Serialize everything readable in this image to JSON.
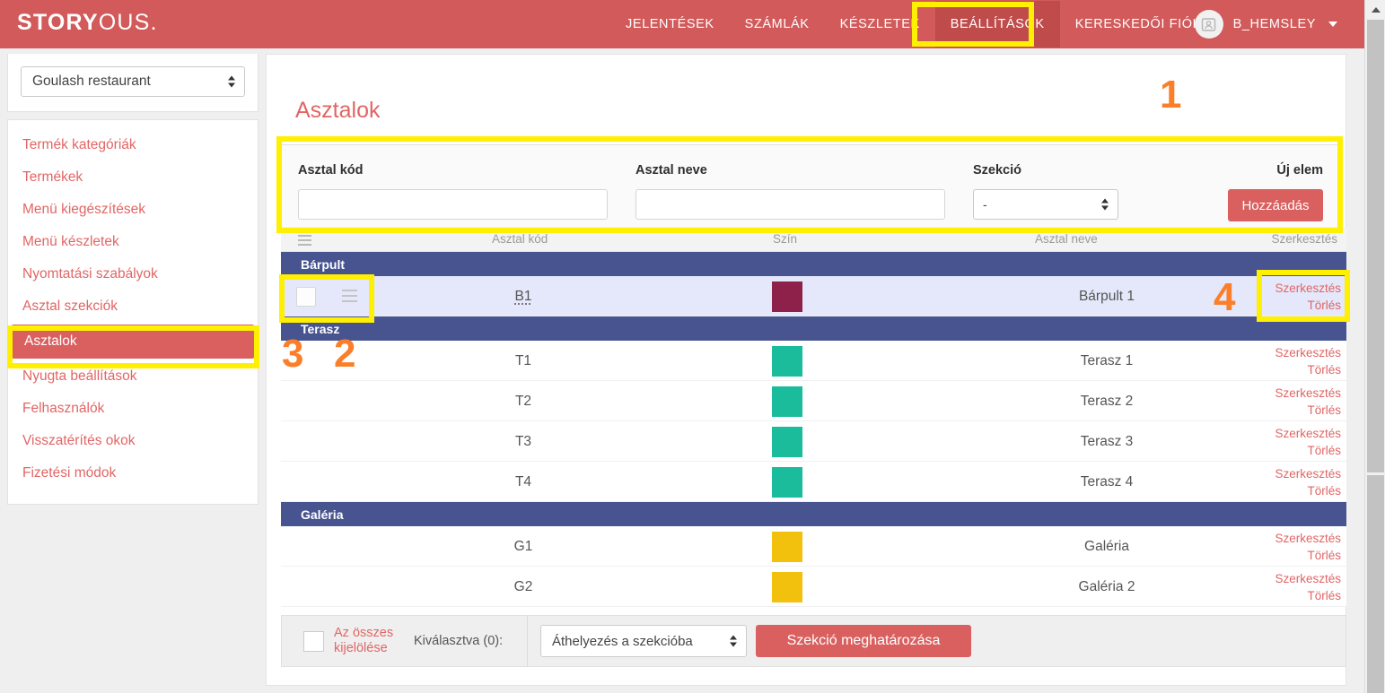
{
  "brand": {
    "bold": "STORY",
    "light": "OUS."
  },
  "topnav": {
    "items": [
      {
        "label": "JELENTÉSEK",
        "active": false
      },
      {
        "label": "SZÁMLÁK",
        "active": false
      },
      {
        "label": "KÉSZLETEK",
        "active": false
      },
      {
        "label": "BEÁLLÍTÁSOK",
        "active": true
      },
      {
        "label": "KERESKEDŐI FIÓK",
        "active": false
      }
    ],
    "user": {
      "name": "B_HEMSLEY",
      "avatar_icon": "user-card-icon",
      "caret_icon": "chevron-down-icon"
    }
  },
  "sidebar": {
    "shop_select": {
      "value": "Goulash restaurant",
      "spinner_icon": "spinner-updown-icon"
    },
    "items": [
      {
        "label": "Termék kategóriák"
      },
      {
        "label": "Termékek"
      },
      {
        "label": "Menü kiegészítések"
      },
      {
        "label": "Menü készletek"
      },
      {
        "label": "Nyomtatási szabályok"
      },
      {
        "label": "Asztal szekciók"
      },
      {
        "label": "Asztalok"
      },
      {
        "label": "Nyugta beállítások"
      },
      {
        "label": "Felhasználók"
      },
      {
        "label": "Visszatérítés okok"
      },
      {
        "label": "Fizetési módok"
      }
    ],
    "active_index": 6
  },
  "page": {
    "title": "Asztalok"
  },
  "form": {
    "code_label": "Asztal kód",
    "code_value": "",
    "name_label": "Asztal neve",
    "name_value": "",
    "section_label": "Szekció",
    "section_value": "-",
    "new_item_label": "Új elem",
    "add_button": "Hozzáadás"
  },
  "table": {
    "headers": {
      "drag": "drag-handle-icon",
      "code": "Asztal kód",
      "color": "Szín",
      "name": "Asztal neve",
      "edit": "Szerkesztés"
    },
    "action_edit": "Szerkesztés",
    "action_delete": "Törlés",
    "sections": [
      {
        "name": "Bárpult",
        "rows": [
          {
            "code": "B1",
            "color": "#8e2149",
            "name": "Bárpult 1",
            "selected": true
          }
        ]
      },
      {
        "name": "Terasz",
        "rows": [
          {
            "code": "T1",
            "color": "#1abc9c",
            "name": "Terasz 1",
            "selected": false
          },
          {
            "code": "T2",
            "color": "#1abc9c",
            "name": "Terasz 2",
            "selected": false
          },
          {
            "code": "T3",
            "color": "#1abc9c",
            "name": "Terasz 3",
            "selected": false
          },
          {
            "code": "T4",
            "color": "#1abc9c",
            "name": "Terasz 4",
            "selected": false
          }
        ]
      },
      {
        "name": "Galéria",
        "rows": [
          {
            "code": "G1",
            "color": "#f2c10e",
            "name": "Galéria",
            "selected": false
          },
          {
            "code": "G2",
            "color": "#f2c10e",
            "name": "Galéria 2",
            "selected": false
          }
        ]
      }
    ]
  },
  "bottombar": {
    "select_all_label": "Az összes kijelölése",
    "selected_label": "Kiválasztva (0):",
    "move_select_value": "Áthelyezés a szekcióba",
    "apply_button": "Szekció meghatározása"
  },
  "annotations": [
    {
      "number": "1"
    },
    {
      "number": "2"
    },
    {
      "number": "3"
    },
    {
      "number": "4"
    }
  ],
  "colors": {
    "brand_red": "#d25a5a",
    "button_red": "#d9605f",
    "link_red": "#e26565",
    "section_indigo": "#47548f",
    "highlight_yellow": "#ffef00",
    "annotation_orange": "#fb7f2a",
    "row_selected": "#e4e8fa"
  }
}
